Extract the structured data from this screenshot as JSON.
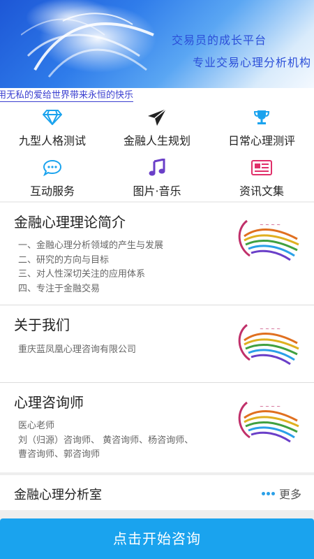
{
  "banner": {
    "line1": "交易员的成长平台",
    "line2": "专业交易心理分析机构"
  },
  "marquee": {
    "text": "用无私的爱给世界带来永恒的快乐"
  },
  "menu": [
    {
      "label": "九型人格测试",
      "icon": "diamond-icon",
      "color": "#1aa3ee"
    },
    {
      "label": "金融人生规划",
      "icon": "paper-plane-icon",
      "color": "#222222"
    },
    {
      "label": "日常心理测评",
      "icon": "trophy-icon",
      "color": "#1aa3ee"
    },
    {
      "label": "互动服务",
      "icon": "chat-bubble-icon",
      "color": "#1aa3ee"
    },
    {
      "label": "图片·音乐",
      "icon": "music-note-icon",
      "color": "#6a3fc8"
    },
    {
      "label": "资讯文集",
      "icon": "newspaper-icon",
      "color": "#e0306a"
    }
  ],
  "sections": [
    {
      "title": "金融心理理论简介",
      "lines": [
        "一、金融心理分析领域的产生与发展",
        "二、研究的方向与目标",
        "三、对人性深切关注的应用体系",
        "四、专注于金融交易"
      ]
    },
    {
      "title": "关于我们",
      "lines": [
        "重庆蓝凤凰心理咨询有限公司"
      ]
    },
    {
      "title": "心理咨询师",
      "lines": [
        "医心老师",
        "刘（归源）咨询师、 黄咨询师、杨咨询师、",
        "曹咨询师、郭咨询师"
      ]
    }
  ],
  "analysis": {
    "title": "金融心理分析室",
    "more_label": "更多"
  },
  "cta": {
    "label": "点击开始咨询"
  },
  "colors": {
    "accent": "#1aa3ee"
  }
}
